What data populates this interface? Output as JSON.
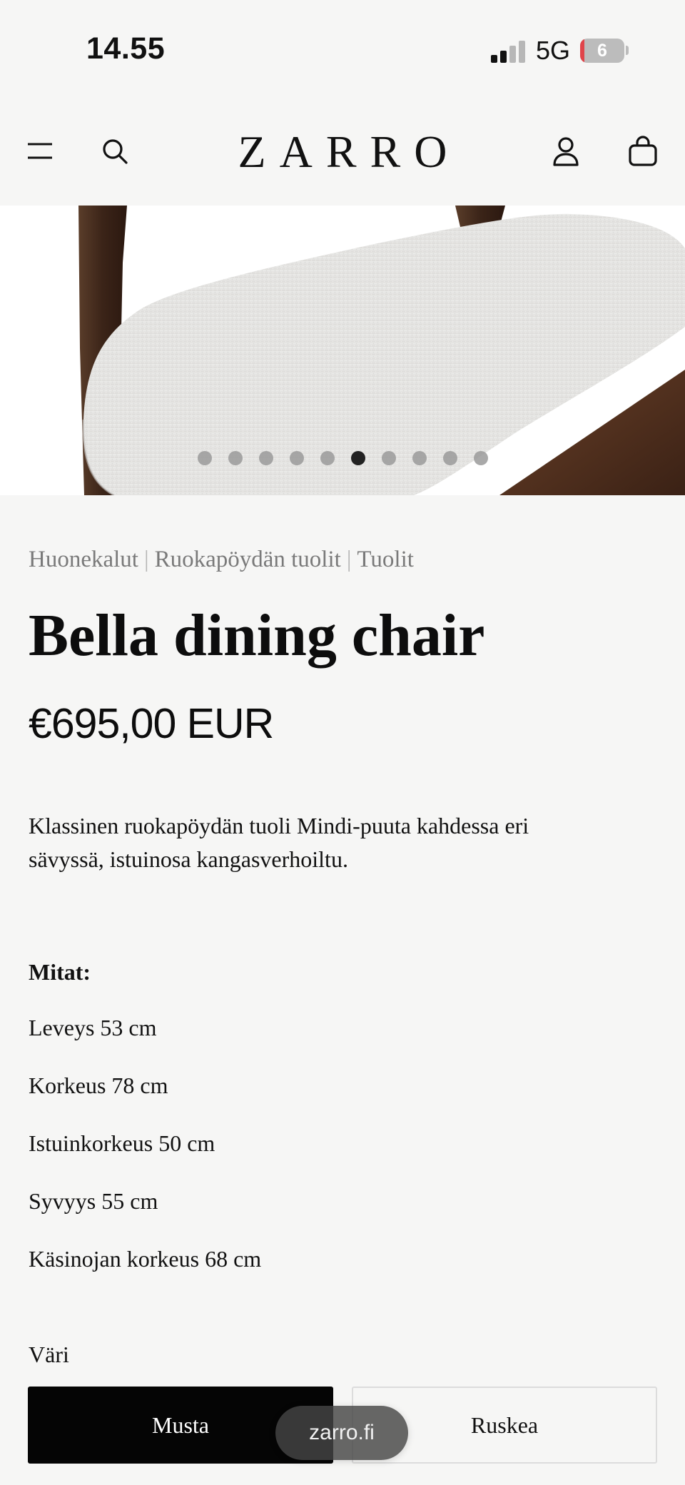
{
  "status_bar": {
    "time": "14.55",
    "network": "5G",
    "battery": "6"
  },
  "header": {
    "logo": "ZARRO",
    "icons": [
      "menu-icon",
      "search-icon",
      "account-icon",
      "bag-icon"
    ]
  },
  "gallery": {
    "image": "chair-seat-closeup",
    "slide_count": 10,
    "active_index": 5
  },
  "product": {
    "breadcrumb": [
      "Huonekalut",
      "Ruokapöydän tuolit",
      "Tuolit"
    ],
    "title": "Bella dining chair",
    "price": "€695,00 EUR",
    "description": "Klassinen ruokapöydän tuoli Mindi-puuta kahdessa eri sävyssä, istuinosa kangasverhoiltu.",
    "dimensions_heading": "Mitat:",
    "dimensions": [
      "Leveys 53 cm",
      "Korkeus 78 cm",
      "Istuinkorkeus 50 cm",
      "Syvyys 55 cm",
      "Käsinojan korkeus 68 cm"
    ],
    "color_label": "Väri",
    "color_options": [
      {
        "label": "Musta",
        "selected": true
      },
      {
        "label": "Ruskea",
        "selected": false
      }
    ]
  },
  "browser": {
    "url": "zarro.fi"
  },
  "colors": {
    "background": "#f6f6f5",
    "text": "#111111",
    "breadcrumb": "#7a7a7a",
    "selected_swatch": "#050505",
    "battery_low": "#e0444a"
  }
}
